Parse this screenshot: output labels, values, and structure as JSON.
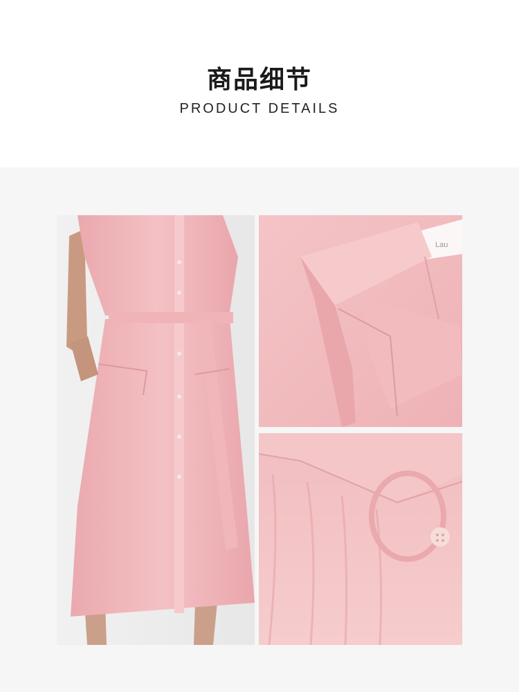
{
  "header": {
    "title_cn": "商品细节",
    "title_en": "PRODUCT DETAILS"
  },
  "images": [
    {
      "name": "full-dress-photo",
      "description": "pink belted shirt dress, front view"
    },
    {
      "name": "collar-detail-photo",
      "description": "collar close-up"
    },
    {
      "name": "belt-detail-photo",
      "description": "belt buckle close-up"
    }
  ],
  "colors": {
    "background_panel": "#f6f6f6",
    "dress_pink": "#f2b9bd",
    "text": "#1a1a1a"
  },
  "collar_label_text": "Lau"
}
